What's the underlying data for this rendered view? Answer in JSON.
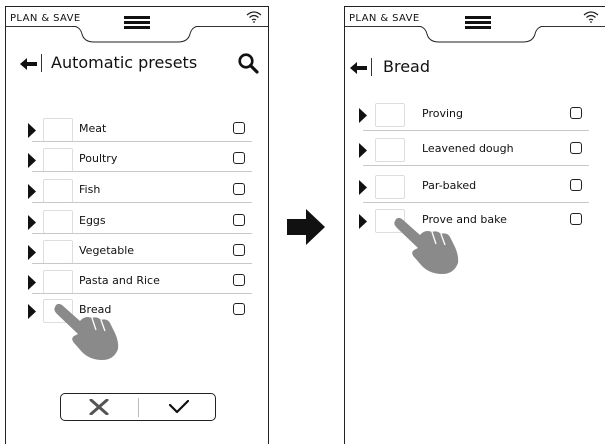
{
  "left_screen": {
    "status_bar": {
      "title": "PLAN & SAVE"
    },
    "header": {
      "title": "Automatic presets"
    },
    "items": [
      {
        "label": "Meat"
      },
      {
        "label": "Poultry"
      },
      {
        "label": "Fish"
      },
      {
        "label": "Eggs"
      },
      {
        "label": "Vegetable"
      },
      {
        "label": "Pasta and Rice"
      },
      {
        "label": "Bread"
      }
    ]
  },
  "right_screen": {
    "status_bar": {
      "title": "PLAN & SAVE"
    },
    "header": {
      "title": "Bread"
    },
    "items": [
      {
        "label": "Proving"
      },
      {
        "label": "Leavened dough"
      },
      {
        "label": "Par-baked"
      },
      {
        "label": "Prove and bake"
      }
    ]
  },
  "icons": {
    "menu": "hamburger-menu-icon",
    "wifi": "wifi-icon",
    "back": "back-arrow-icon",
    "search": "search-icon",
    "expand": "triangle-right-icon",
    "pointer": "hand-pointer-icon",
    "next": "right-arrow-icon",
    "cancel": "x-icon",
    "confirm": "checkmark-icon"
  },
  "colors": {
    "ink": "#111111",
    "divider": "#c8c8c8",
    "hand": "#8a8a8a"
  }
}
